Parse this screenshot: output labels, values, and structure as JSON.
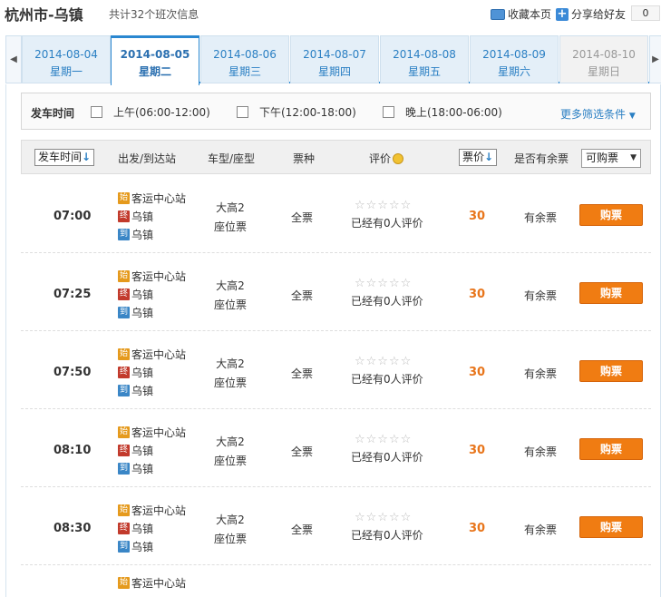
{
  "header": {
    "title": "杭州市-乌镇",
    "subtitle": "共计32个班次信息",
    "favorite_label": "收藏本页",
    "share_label": "分享给好友",
    "share_count": "0"
  },
  "date_tabs": [
    {
      "date": "2014-08-04",
      "weekday": "星期一",
      "state": "normal"
    },
    {
      "date": "2014-08-05",
      "weekday": "星期二",
      "state": "active"
    },
    {
      "date": "2014-08-06",
      "weekday": "星期三",
      "state": "normal"
    },
    {
      "date": "2014-08-07",
      "weekday": "星期四",
      "state": "normal"
    },
    {
      "date": "2014-08-08",
      "weekday": "星期五",
      "state": "normal"
    },
    {
      "date": "2014-08-09",
      "weekday": "星期六",
      "state": "normal"
    },
    {
      "date": "2014-08-10",
      "weekday": "星期日",
      "state": "disabled"
    }
  ],
  "filter": {
    "label": "发车时间",
    "options": [
      "上午(06:00-12:00)",
      "下午(12:00-18:00)",
      "晚上(18:00-06:00)"
    ],
    "more_label": "更多筛选条件"
  },
  "columns": {
    "depart_time": "发车时间",
    "stations": "出发/到达站",
    "bus_type": "车型/座型",
    "ticket_type": "票种",
    "rating": "评价",
    "price": "票价",
    "availability": "是否有余票",
    "filter_select": "可购票"
  },
  "rows": [
    {
      "time": "07:00",
      "from_badge": "始",
      "from": "客运中心站",
      "via_badge": "终",
      "via": "乌镇",
      "to_badge": "到",
      "to": "乌镇",
      "bus": "大高2",
      "seat": "座位票",
      "ticket": "全票",
      "stars": "☆☆☆☆☆",
      "reviews": "已经有0人评价",
      "price": "30",
      "availability": "有余票",
      "buy": "购票"
    },
    {
      "time": "07:25",
      "from_badge": "始",
      "from": "客运中心站",
      "via_badge": "终",
      "via": "乌镇",
      "to_badge": "到",
      "to": "乌镇",
      "bus": "大高2",
      "seat": "座位票",
      "ticket": "全票",
      "stars": "☆☆☆☆☆",
      "reviews": "已经有0人评价",
      "price": "30",
      "availability": "有余票",
      "buy": "购票"
    },
    {
      "time": "07:50",
      "from_badge": "始",
      "from": "客运中心站",
      "via_badge": "终",
      "via": "乌镇",
      "to_badge": "到",
      "to": "乌镇",
      "bus": "大高2",
      "seat": "座位票",
      "ticket": "全票",
      "stars": "☆☆☆☆☆",
      "reviews": "已经有0人评价",
      "price": "30",
      "availability": "有余票",
      "buy": "购票"
    },
    {
      "time": "08:10",
      "from_badge": "始",
      "from": "客运中心站",
      "via_badge": "终",
      "via": "乌镇",
      "to_badge": "到",
      "to": "乌镇",
      "bus": "大高2",
      "seat": "座位票",
      "ticket": "全票",
      "stars": "☆☆☆☆☆",
      "reviews": "已经有0人评价",
      "price": "30",
      "availability": "有余票",
      "buy": "购票"
    },
    {
      "time": "08:30",
      "from_badge": "始",
      "from": "客运中心站",
      "via_badge": "终",
      "via": "乌镇",
      "to_badge": "到",
      "to": "乌镇",
      "bus": "大高2",
      "seat": "座位票",
      "ticket": "全票",
      "stars": "☆☆☆☆☆",
      "reviews": "已经有0人评价",
      "price": "30",
      "availability": "有余票",
      "buy": "购票"
    },
    {
      "time": "",
      "from_badge": "始",
      "from": "客运中心站",
      "via_badge": "",
      "via": "",
      "to_badge": "",
      "to": "",
      "bus": "",
      "seat": "",
      "ticket": "",
      "stars": "",
      "reviews": "",
      "price": "",
      "availability": "",
      "buy": ""
    }
  ],
  "colors": {
    "accent": "#2a87d0",
    "price": "#e8751b",
    "buy_button": "#f07c12"
  }
}
